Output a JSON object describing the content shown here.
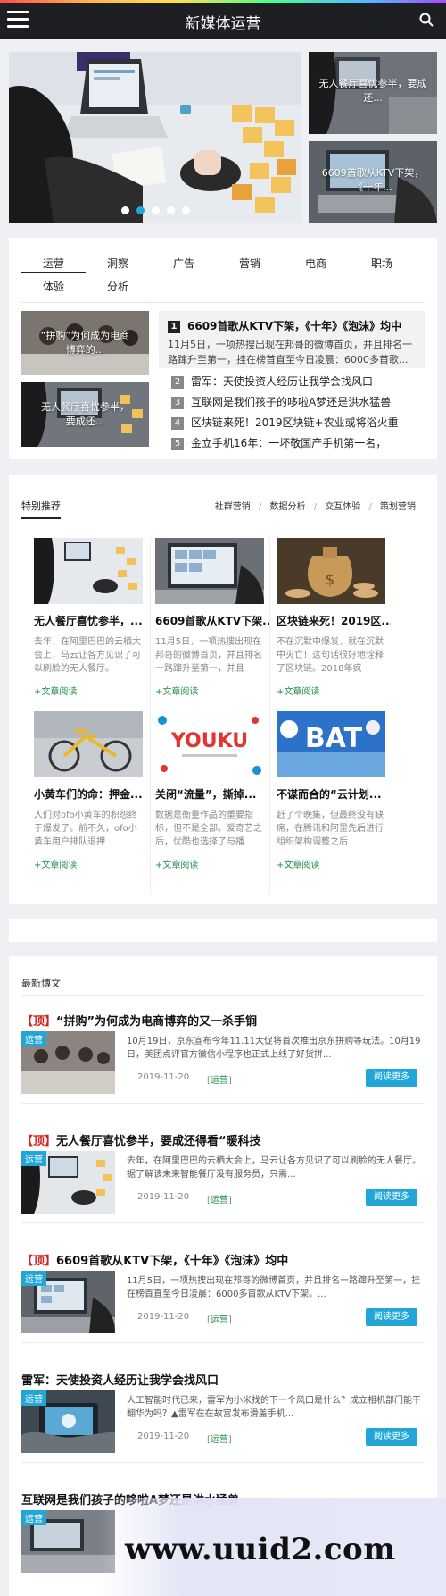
{
  "header": {
    "title": "新媒体运营"
  },
  "hero": {
    "side_items": [
      {
        "caption": "无人餐厅喜忧参半，要成还..."
      },
      {
        "caption": "6609首歌从KTV下架，《十年..."
      }
    ],
    "dot_count": 5,
    "active_dot": 1
  },
  "tabs": {
    "items": [
      "运营",
      "洞察",
      "广告",
      "营销",
      "电商",
      "职场",
      "体验",
      "分析"
    ],
    "active": "运营"
  },
  "tab_panel": {
    "thumbs": [
      {
        "caption": "“拼购”为何成为电商博弈的..."
      },
      {
        "caption": "无人餐厅喜忧参半，要成还..."
      }
    ],
    "featured": {
      "rank": "1",
      "title": "6609首歌从KTV下架，《十年》《泡沫》均中",
      "desc": "11月5日，一项热搜出现在邦哥的微博首页，并且排名一路蹿升至第一，挂在榜首直至今日凌晨：6000多首歌..."
    },
    "ranks": [
      {
        "num": "2",
        "text": "雷军：天使投资人经历让我学会找风口"
      },
      {
        "num": "3",
        "text": "互联网是我们孩子的哆啦A梦还是洪水猛兽"
      },
      {
        "num": "4",
        "text": "区块链来死！2019区块链+农业或将浴火重"
      },
      {
        "num": "5",
        "text": "金立手机16年：一坏敬国产手机第一名，"
      }
    ]
  },
  "recommend": {
    "heading": "特别推荐",
    "categories": [
      "社群营销",
      "数据分析",
      "交互体验",
      "策划营销"
    ],
    "more_label": "+文章阅读",
    "items": [
      {
        "title": "无人餐厅喜忧参半，...",
        "desc": "去年，在阿里巴巴的云栖大会上，马云让各方见识了可以刷脸的无人餐厅。"
      },
      {
        "title": "6609首歌从KTV下架...",
        "desc": "11月5日，一项热搜出现在邦哥的微博首页，并且排名一路蹿升至第一，并且"
      },
      {
        "title": "区块链来死！2019区...",
        "desc": "不在沉默中爆发，就在沉默中灭亡！这句话很好地诠释了区块链。2018年疯"
      },
      {
        "title": "小黄车们的命：押金...",
        "desc": "人们对ofo小黄车的积怨终于爆发了。前不久，ofo小黄车用户排队退押"
      },
      {
        "title": "关闭“流量”，撕掉...",
        "desc": "数据是衡量作品的重要指标，但不是全部。爱奇艺之后，优酷也选择了与播"
      },
      {
        "title": "不谋而合的“云计划...",
        "desc": "赶了个晚集，但最终没有缺席，在腾讯和阿里先后进行组织架构调整之后"
      }
    ]
  },
  "blog": {
    "heading": "最新博文",
    "read_more_label": "阅读更多",
    "posts": [
      {
        "top": "【顶】",
        "title": "“拼购”为何成为电商博弈的又一杀手锏",
        "tag": "运营",
        "excerpt": "10月19日，京东宣布今年11.11大促将首次推出京东拼购等玩法。10月19日，美团点评官方微信小程序也正式上线了好货拼...",
        "date": "2019-11-20",
        "category": "运营"
      },
      {
        "top": "【顶】",
        "title": "无人餐厅喜忧参半，要成还得看“暖科技",
        "tag": "运营",
        "excerpt": "去年，在阿里巴巴的云栖大会上，马云让各方见识了可以刷脸的无人餐厅。据了解该未来智能餐厅没有服务员，只需...",
        "date": "2019-11-20",
        "category": "运营"
      },
      {
        "top": "【顶】",
        "title": "6609首歌从KTV下架，《十年》《泡沫》均中",
        "tag": "运营",
        "excerpt": "11月5日，一项热搜出现在邦哥的微博首页，并且排名一路蹿升至第一，挂在榜首直至今日凌晨：6000多首歌从KTV下架。...",
        "date": "2019-11-20",
        "category": "运营"
      },
      {
        "top": "",
        "title": "雷军：天使投资人经历让我学会找风口",
        "tag": "运营",
        "excerpt": "人工智能时代已来，雷军为小米找的下一个风口是什么？成立相机部门能干翻华为吗？▲雷军在在故宫发布滑盖手机...",
        "date": "2019-11-20",
        "category": "运营"
      },
      {
        "top": "",
        "title": "互联网是我们孩子的哆啦A梦还是洪水猛兽",
        "tag": "运营",
        "excerpt": "",
        "date": "",
        "category": ""
      }
    ]
  },
  "watermark": {
    "text": "www.uuid2.com"
  }
}
